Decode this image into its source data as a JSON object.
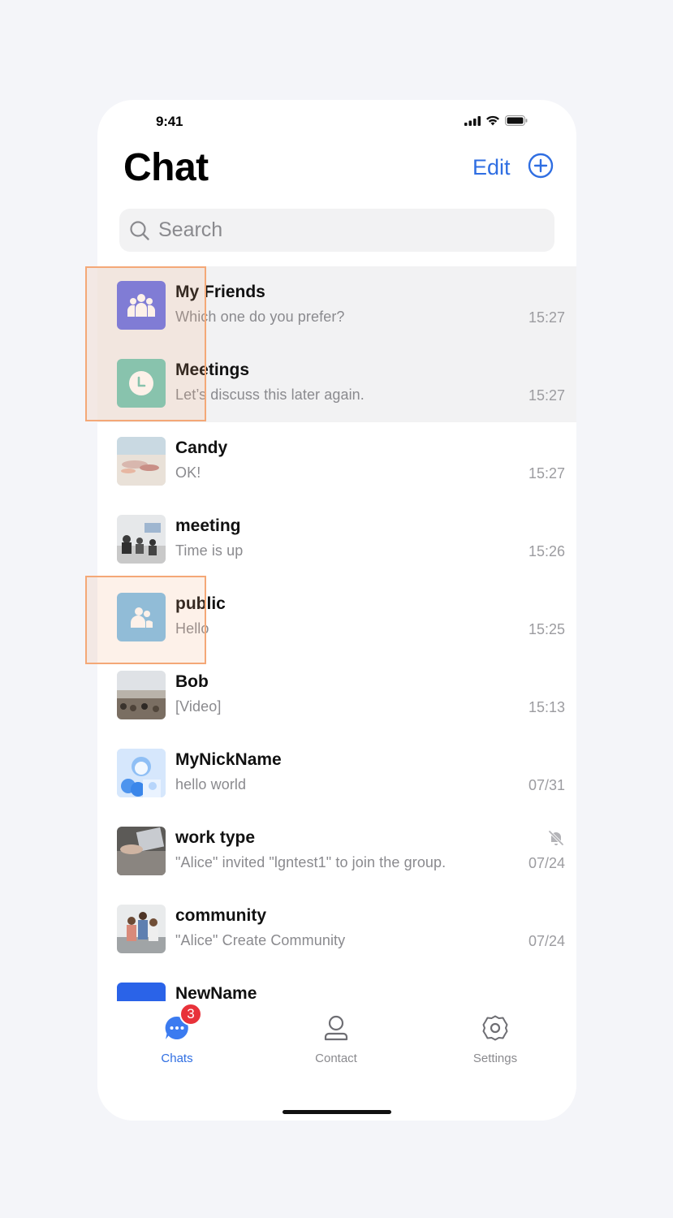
{
  "status_bar": {
    "time": "9:41"
  },
  "header": {
    "title": "Chat",
    "edit_label": "Edit",
    "add_icon": "plus-circle-icon"
  },
  "search": {
    "placeholder": "Search"
  },
  "colors": {
    "accent": "#2f6ee2",
    "badge": "#e8323a",
    "pinned_bg": "#f2f2f3"
  },
  "chats": [
    {
      "name": "My Friends",
      "preview": "Which one do you prefer?",
      "time": "15:27",
      "pinned": true,
      "avatar": "group-avatar"
    },
    {
      "name": "Meetings",
      "preview": "Let’s discuss this later again.",
      "time": "15:27",
      "pinned": true,
      "avatar": "clock-avatar"
    },
    {
      "name": "Candy",
      "preview": "OK!",
      "time": "15:27",
      "pinned": false,
      "avatar": "photo-avatar"
    },
    {
      "name": "meeting",
      "preview": "Time is up",
      "time": "15:26",
      "pinned": false,
      "avatar": "photo-avatar"
    },
    {
      "name": "public",
      "preview": "Hello",
      "time": "15:25",
      "pinned": false,
      "avatar": "community-avatar"
    },
    {
      "name": "Bob",
      "preview": "[Video]",
      "time": "15:13",
      "pinned": false,
      "avatar": "photo-avatar"
    },
    {
      "name": "MyNickName",
      "preview": "hello world",
      "time": "07/31",
      "pinned": false,
      "avatar": "illustration-avatar"
    },
    {
      "name": "work type",
      "preview": "\"Alice\" invited \"lgntest1\" to join the group.",
      "time": "07/24",
      "pinned": false,
      "muted": true,
      "avatar": "photo-avatar"
    },
    {
      "name": "community",
      "preview": "\"Alice\" Create Community",
      "time": "07/24",
      "pinned": false,
      "avatar": "photo-avatar"
    },
    {
      "name": "NewName",
      "preview": "",
      "time": "",
      "pinned": false,
      "avatar": "blue-avatar"
    }
  ],
  "tabs": [
    {
      "label": "Chats",
      "icon": "chat-bubble-icon",
      "badge": "3",
      "active": true
    },
    {
      "label": "Contact",
      "icon": "person-icon",
      "active": false
    },
    {
      "label": "Settings",
      "icon": "gear-icon",
      "active": false
    }
  ]
}
